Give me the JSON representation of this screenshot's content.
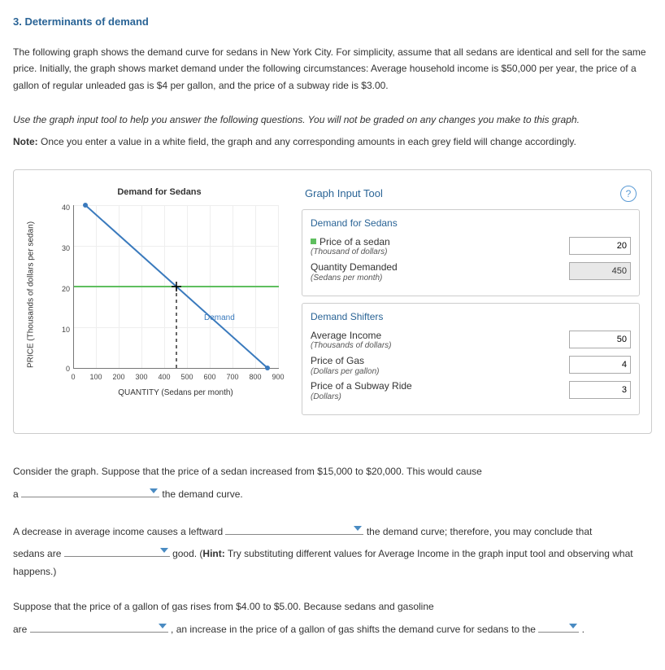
{
  "heading": "3. Determinants of demand",
  "intro": [
    "The following graph shows the demand curve for sedans in New York City. For simplicity, assume that all sedans are identical and sell for the same price. Initially, the graph shows market demand under the following circumstances: Average household income is $50,000 per year, the price of a gallon of regular unleaded gas is $4 per gallon, and the price of a subway ride is $3.00."
  ],
  "instructions": {
    "use_line": "Use the graph input tool to help you answer the following questions. You will not be graded on any changes you make to this graph.",
    "note_label": "Note:",
    "note_text": " Once you enter a value in a white field, the graph and any corresponding amounts in each grey field will change accordingly."
  },
  "chart_data": {
    "type": "line",
    "title": "Demand for Sedans",
    "xlabel": "QUANTITY (Sedans per month)",
    "ylabel": "PRICE (Thousands of dollars per sedan)",
    "xlim": [
      0,
      900
    ],
    "ylim": [
      0,
      40
    ],
    "x_ticks": [
      0,
      100,
      200,
      300,
      400,
      500,
      600,
      700,
      800,
      900
    ],
    "y_ticks": [
      0,
      10,
      20,
      30,
      40
    ],
    "series": [
      {
        "name": "Demand",
        "color": "#3a7abd",
        "points": [
          [
            50,
            40
          ],
          [
            850,
            0
          ]
        ]
      },
      {
        "name": "PriceLine",
        "color": "#5fbf5f",
        "points": [
          [
            0,
            20
          ],
          [
            900,
            20
          ]
        ]
      },
      {
        "name": "Dropline",
        "color": "#333",
        "dashed": true,
        "points": [
          [
            450,
            20
          ],
          [
            450,
            0
          ]
        ]
      }
    ],
    "intersection": {
      "x": 450,
      "y": 20
    },
    "series_label": "Demand"
  },
  "tool": {
    "header": "Graph Input Tool",
    "help_tooltip": "?",
    "panel1_title": "Demand for Sedans",
    "price_label": "Price of a sedan",
    "price_sub": "(Thousand of dollars)",
    "price_value": "20",
    "qty_label": "Quantity Demanded",
    "qty_sub": "(Sedans per month)",
    "qty_value": "450",
    "panel2_title": "Demand Shifters",
    "income_label": "Average Income",
    "income_sub": "(Thousands of dollars)",
    "income_value": "50",
    "gas_label": "Price of Gas",
    "gas_sub": "(Dollars per gallon)",
    "gas_value": "4",
    "subway_label": "Price of a Subway Ride",
    "subway_sub": "(Dollars)",
    "subway_value": "3"
  },
  "q1": {
    "line1": "Consider the graph. Suppose that the price of a sedan increased from $15,000 to $20,000. This would cause",
    "line2a": "a",
    "line2b": " the demand curve."
  },
  "q2": {
    "line1a": "A decrease in average income causes a leftward ",
    "line1b": " the demand curve; therefore, you may conclude that",
    "line2a": "sedans are ",
    "line2b": " good. (",
    "hint_label": "Hint:",
    "hint_text": " Try substituting different values for Average Income in the graph input tool and observing what happens.)"
  },
  "q3": {
    "line1": "Suppose that the price of a gallon of gas rises from $4.00 to $5.00. Because sedans and gasoline",
    "line2a": "are ",
    "line2b": " , an increase in the price of a gallon of gas shifts the demand curve for sedans to the ",
    "line2c": " ."
  }
}
